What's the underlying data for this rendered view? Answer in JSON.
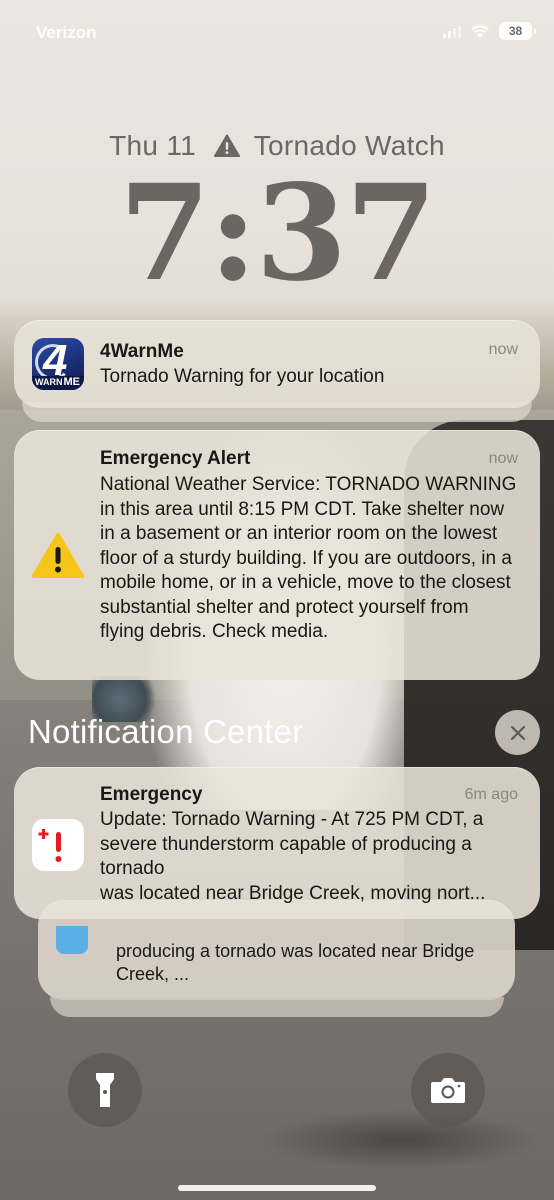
{
  "status_bar": {
    "carrier": "Verizon",
    "battery": "38"
  },
  "lock_screen": {
    "date": "Thu 11",
    "watch_label": "Tornado Watch",
    "time": "7:37"
  },
  "notifications": [
    {
      "app": "4WarnMe",
      "time": "now",
      "body": "Tornado Warning for your location",
      "icon": "4warnme-app-icon"
    },
    {
      "app": "Emergency Alert",
      "time": "now",
      "body": "National Weather Service: TORNADO WARNING in this area until 8:15 PM CDT. Take shelter now in a basement or an interior room on the lowest floor of a sturdy building. If you are outdoors, in a mobile home, or in a vehicle, move to the closest substantial shelter and protect yourself from flying debris. Check media.",
      "icon": "warning-triangle-icon"
    }
  ],
  "notification_center": {
    "title": "Notification Center",
    "items": [
      {
        "app": "Emergency",
        "time": "6m ago",
        "body": "Update: Tornado Warning - At 725 PM CDT, a severe thunderstorm capable of producing a tornado\nwas located near Bridge Creek, moving nort...",
        "icon": "emergency-app-icon"
      }
    ],
    "stacked_preview": "producing a tornado was located near Bridge Creek, ..."
  },
  "colors": {
    "warning_yellow": "#f5c518",
    "emergency_red": "#e01b24",
    "clock_gray": "#6a6662"
  },
  "controls": {
    "left": "flashlight-icon",
    "right": "camera-icon"
  }
}
